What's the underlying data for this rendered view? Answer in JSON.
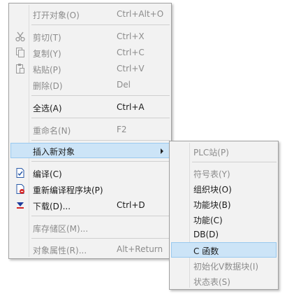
{
  "context_menu": {
    "items": [
      {
        "label": "打开对象(O)",
        "shortcut": "Ctrl+Alt+O"
      },
      {
        "label": "剪切(T)",
        "shortcut": "Ctrl+X",
        "icon": "scissors-icon"
      },
      {
        "label": "复制(Y)",
        "shortcut": "Ctrl+C",
        "icon": "copy-icon"
      },
      {
        "label": "粘贴(P)",
        "shortcut": "Ctrl+V",
        "icon": "paste-icon"
      },
      {
        "label": "删除(D)",
        "shortcut": "Del"
      },
      {
        "label": "全选(A)",
        "shortcut": "Ctrl+A"
      },
      {
        "label": "重命名(N)",
        "shortcut": "F2"
      },
      {
        "label": "插入新对象"
      },
      {
        "label": "编译(C)",
        "icon": "compile-icon"
      },
      {
        "label": "重新编译程序块(P)",
        "icon": "recompile-icon"
      },
      {
        "label": "下载(D)...",
        "shortcut": "Ctrl+D",
        "icon": "download-icon"
      },
      {
        "label": "库存储区(M)..."
      },
      {
        "label": "对象属性(R)...",
        "shortcut": "Alt+Return"
      }
    ]
  },
  "submenu": {
    "items": [
      {
        "label": "PLC站(P)"
      },
      {
        "label": "符号表(Y)"
      },
      {
        "label": "组织块(O)"
      },
      {
        "label": "功能块(B)"
      },
      {
        "label": "功能(C)"
      },
      {
        "label": "DB(D)"
      },
      {
        "label": "C 函数"
      },
      {
        "label": "初始化V数据块(I)"
      },
      {
        "label": "状态表(S)"
      }
    ]
  },
  "colors": {
    "highlight": "#cce4f7",
    "highlight_border": "#99c9ef",
    "disabled": "#8c8c8c"
  }
}
